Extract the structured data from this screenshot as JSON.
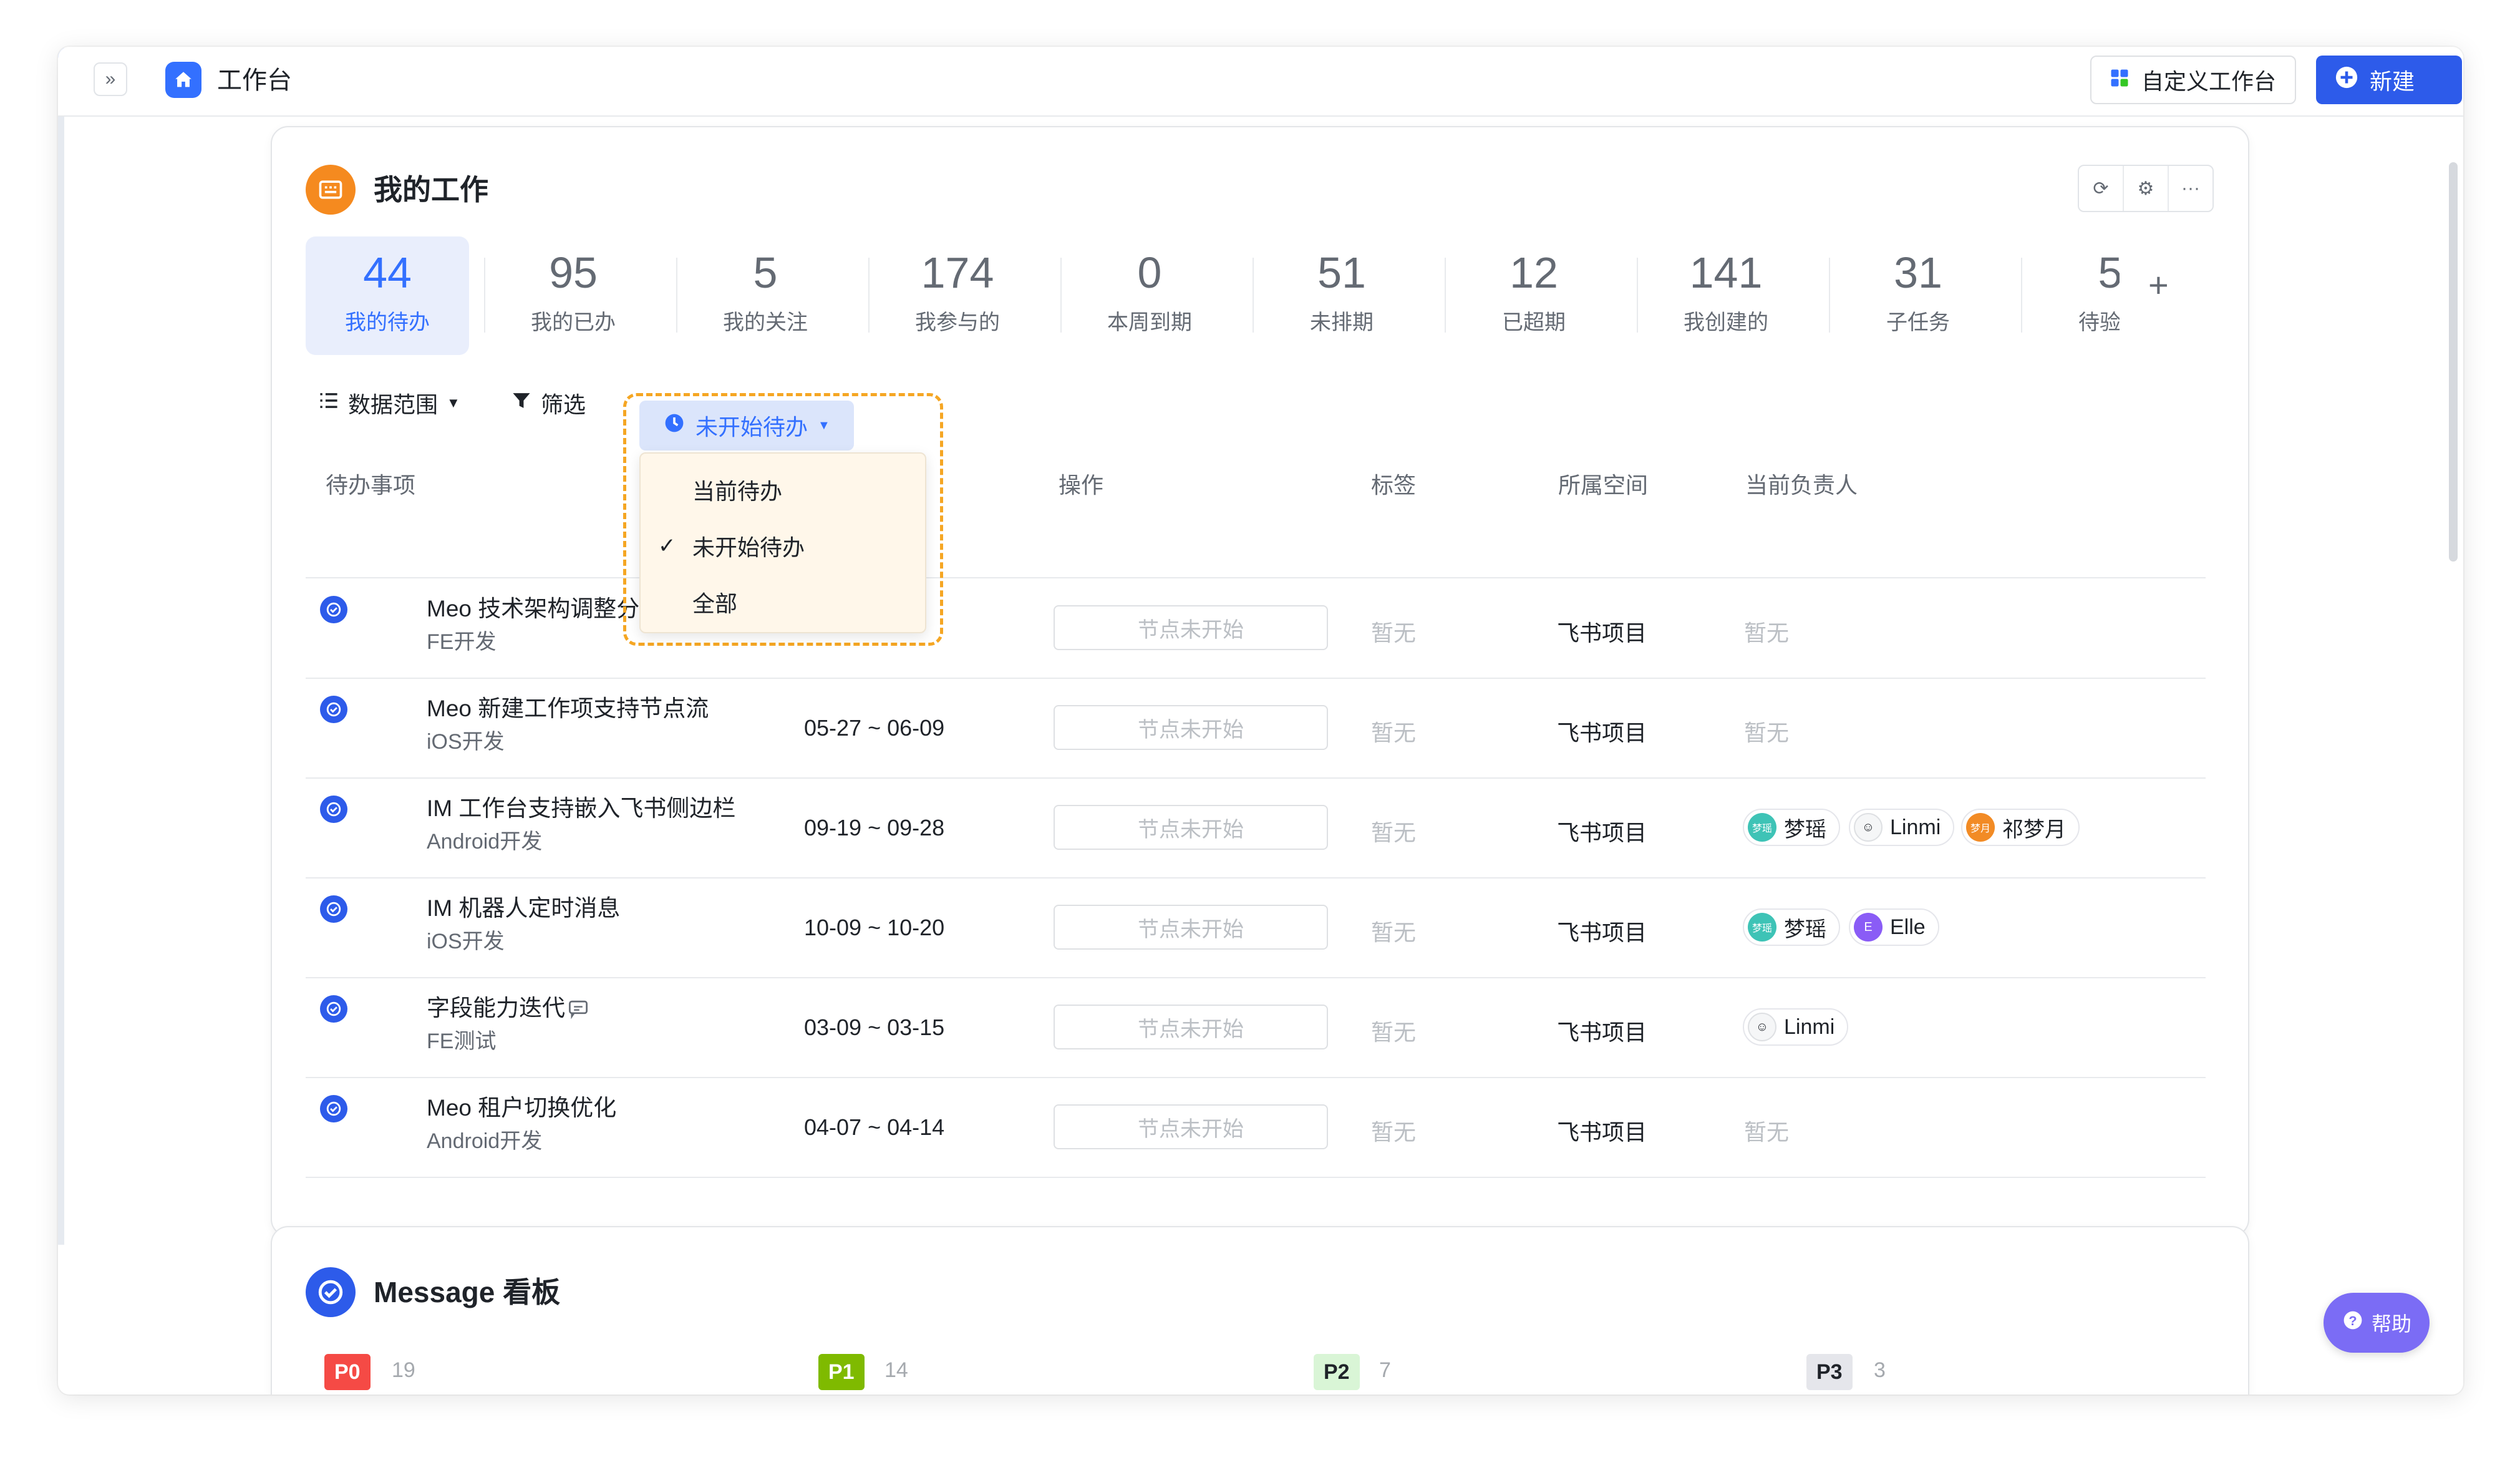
{
  "app": {
    "title": "工作台"
  },
  "toolbar": {
    "customize_label": "自定义工作台",
    "new_label": "新建"
  },
  "work_card": {
    "title": "我的工作",
    "stats": [
      {
        "value": "44",
        "label": "我的待办",
        "active": true
      },
      {
        "value": "95",
        "label": "我的已办"
      },
      {
        "value": "5",
        "label": "我的关注"
      },
      {
        "value": "174",
        "label": "我参与的"
      },
      {
        "value": "0",
        "label": "本周到期"
      },
      {
        "value": "51",
        "label": "未排期"
      },
      {
        "value": "12",
        "label": "已超期"
      },
      {
        "value": "141",
        "label": "我创建的"
      },
      {
        "value": "31",
        "label": "子任务"
      },
      {
        "value": "5",
        "label": "待验收"
      }
    ],
    "filters": {
      "range_label": "数据范围",
      "filter_label": "筛选",
      "status_label": "未开始待办"
    },
    "dropdown": {
      "options": [
        {
          "label": "当前待办",
          "checked": false
        },
        {
          "label": "未开始待办",
          "checked": true
        },
        {
          "label": "全部",
          "checked": false
        }
      ]
    },
    "columns": {
      "task": "待办事项",
      "action": "操作",
      "tags": "标签",
      "space": "所属空间",
      "owner": "当前负责人"
    },
    "rows": [
      {
        "title": "Meo 技术架构调整分析",
        "sub": "FE开发",
        "date": "",
        "action": "节点未开始",
        "tags": "暂无",
        "space": "飞书项目",
        "owners_text": "暂无"
      },
      {
        "title": "Meo 新建工作项支持节点流",
        "sub": "iOS开发",
        "date": "05-27 ~ 06-09",
        "action": "节点未开始",
        "tags": "暂无",
        "space": "飞书项目",
        "owners_text": "暂无"
      },
      {
        "title": "IM 工作台支持嵌入飞书侧边栏",
        "sub": "Android开发",
        "date": "09-19 ~ 09-28",
        "action": "节点未开始",
        "tags": "暂无",
        "space": "飞书项目",
        "owners": [
          "梦瑶",
          "Linmi",
          "祁梦月"
        ]
      },
      {
        "title": "IM 机器人定时消息",
        "sub": "iOS开发",
        "date": "10-09 ~ 10-20",
        "action": "节点未开始",
        "tags": "暂无",
        "space": "飞书项目",
        "owners": [
          "梦瑶",
          "Elle"
        ]
      },
      {
        "title": "字段能力迭代",
        "sub": "FE测试",
        "date": "03-09 ~ 03-15",
        "action": "节点未开始",
        "tags": "暂无",
        "space": "飞书项目",
        "owners": [
          "Linmi"
        ]
      },
      {
        "title": "Meo 租户切换优化",
        "sub": "Android开发",
        "date": "04-07 ~ 04-14",
        "action": "节点未开始",
        "tags": "暂无",
        "space": "飞书项目",
        "owners_text": "暂无"
      }
    ],
    "avatar_initials": {
      "mengyao": "梦瑶",
      "elle": "E",
      "qimengyue": "梦月"
    }
  },
  "message_card": {
    "title": "Message 看板",
    "priorities": [
      {
        "label": "P0",
        "count": "19",
        "bg": "#f54a45",
        "fg": "#ffffff"
      },
      {
        "label": "P1",
        "count": "14",
        "bg": "#7fba00",
        "fg": "#ffffff"
      },
      {
        "label": "P2",
        "count": "7",
        "bg": "#d9f5d6",
        "fg": "#1f2329"
      },
      {
        "label": "P3",
        "count": "3",
        "bg": "#e5e6eb",
        "fg": "#1f2329"
      }
    ]
  },
  "help": {
    "label": "帮助"
  },
  "colors": {
    "accent": "#3370ff",
    "highlight_dash": "#f5a623",
    "help_purple": "#7b6cf5"
  },
  "icons": [
    "expand-icon",
    "home-icon",
    "grid-icon",
    "plus-circle-icon",
    "refresh-icon",
    "gear-icon",
    "more-icon",
    "list-icon",
    "filter-icon",
    "clock-icon",
    "check-icon",
    "task-check-icon",
    "comment-icon",
    "question-icon"
  ]
}
